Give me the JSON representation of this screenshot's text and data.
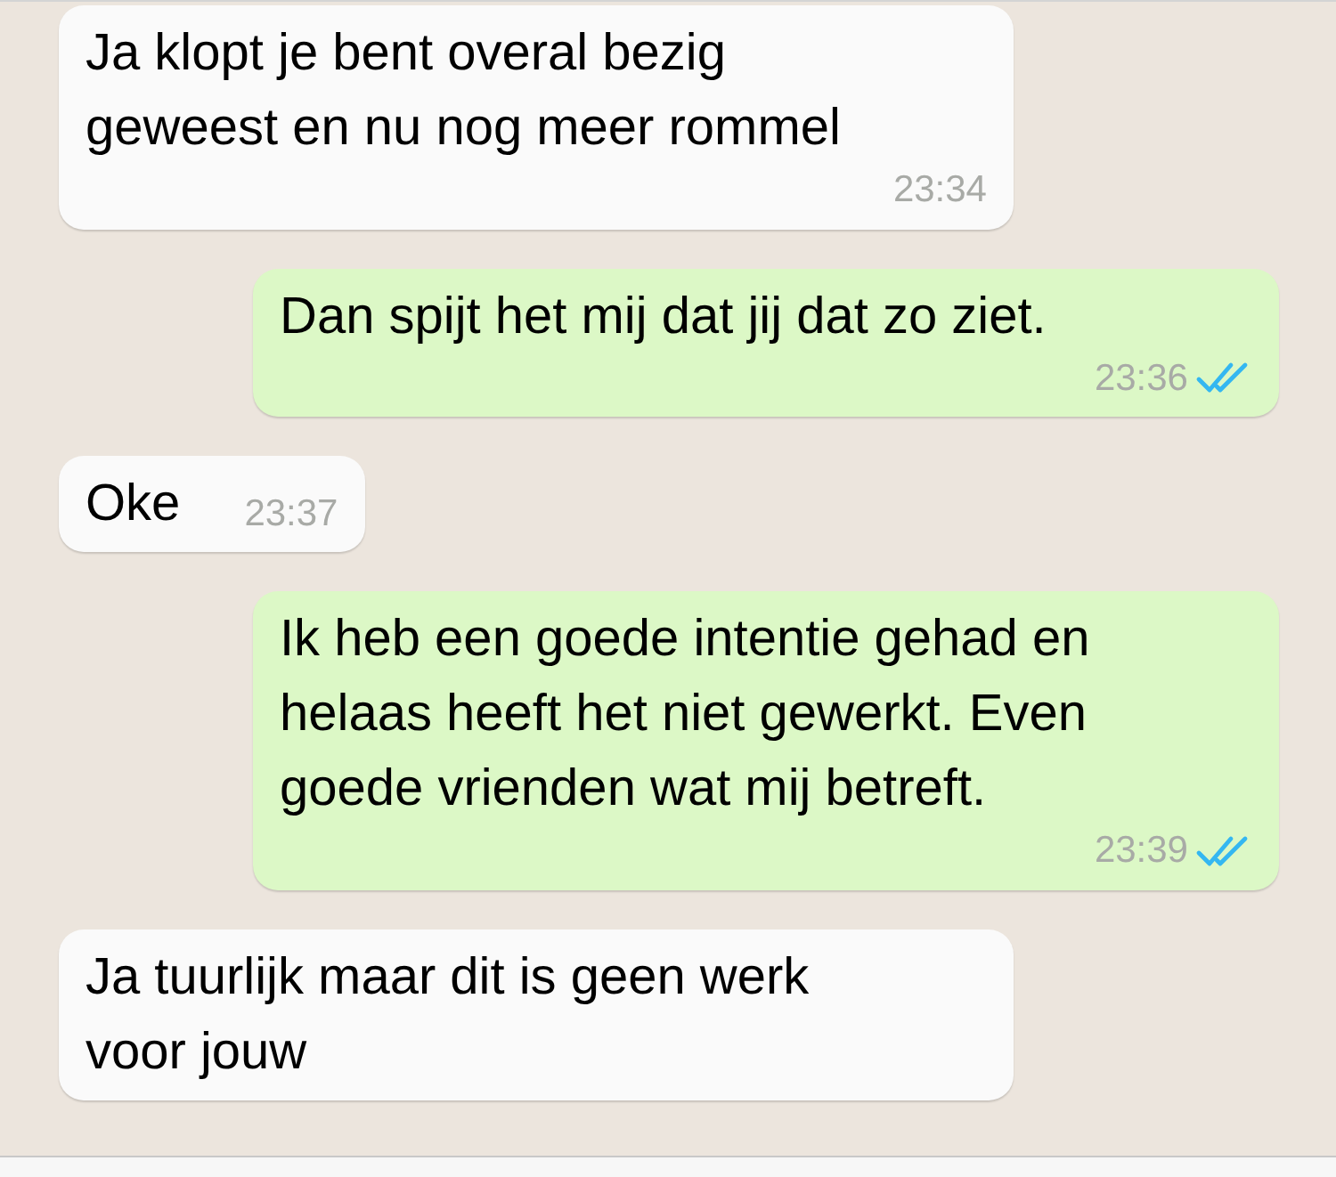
{
  "messages": [
    {
      "kind": "incoming",
      "text": "Ja klopt je bent overal bezig\ngeweest en nu nog meer rommel",
      "time": "23:34"
    },
    {
      "kind": "outgoing",
      "text": "Dan spijt het mij dat jij dat zo ziet.",
      "time": "23:36",
      "read": true
    },
    {
      "kind": "incoming",
      "text": "Oke",
      "time": "23:37"
    },
    {
      "kind": "outgoing",
      "text": "Ik heb een goede intentie gehad en\nhelaas heeft het niet gewerkt. Even\ngoede vrienden wat mij betreft.",
      "time": "23:39",
      "read": true
    },
    {
      "kind": "incoming",
      "text": "Ja tuurlijk maar dit is geen werk\nvoor jouw"
    }
  ]
}
